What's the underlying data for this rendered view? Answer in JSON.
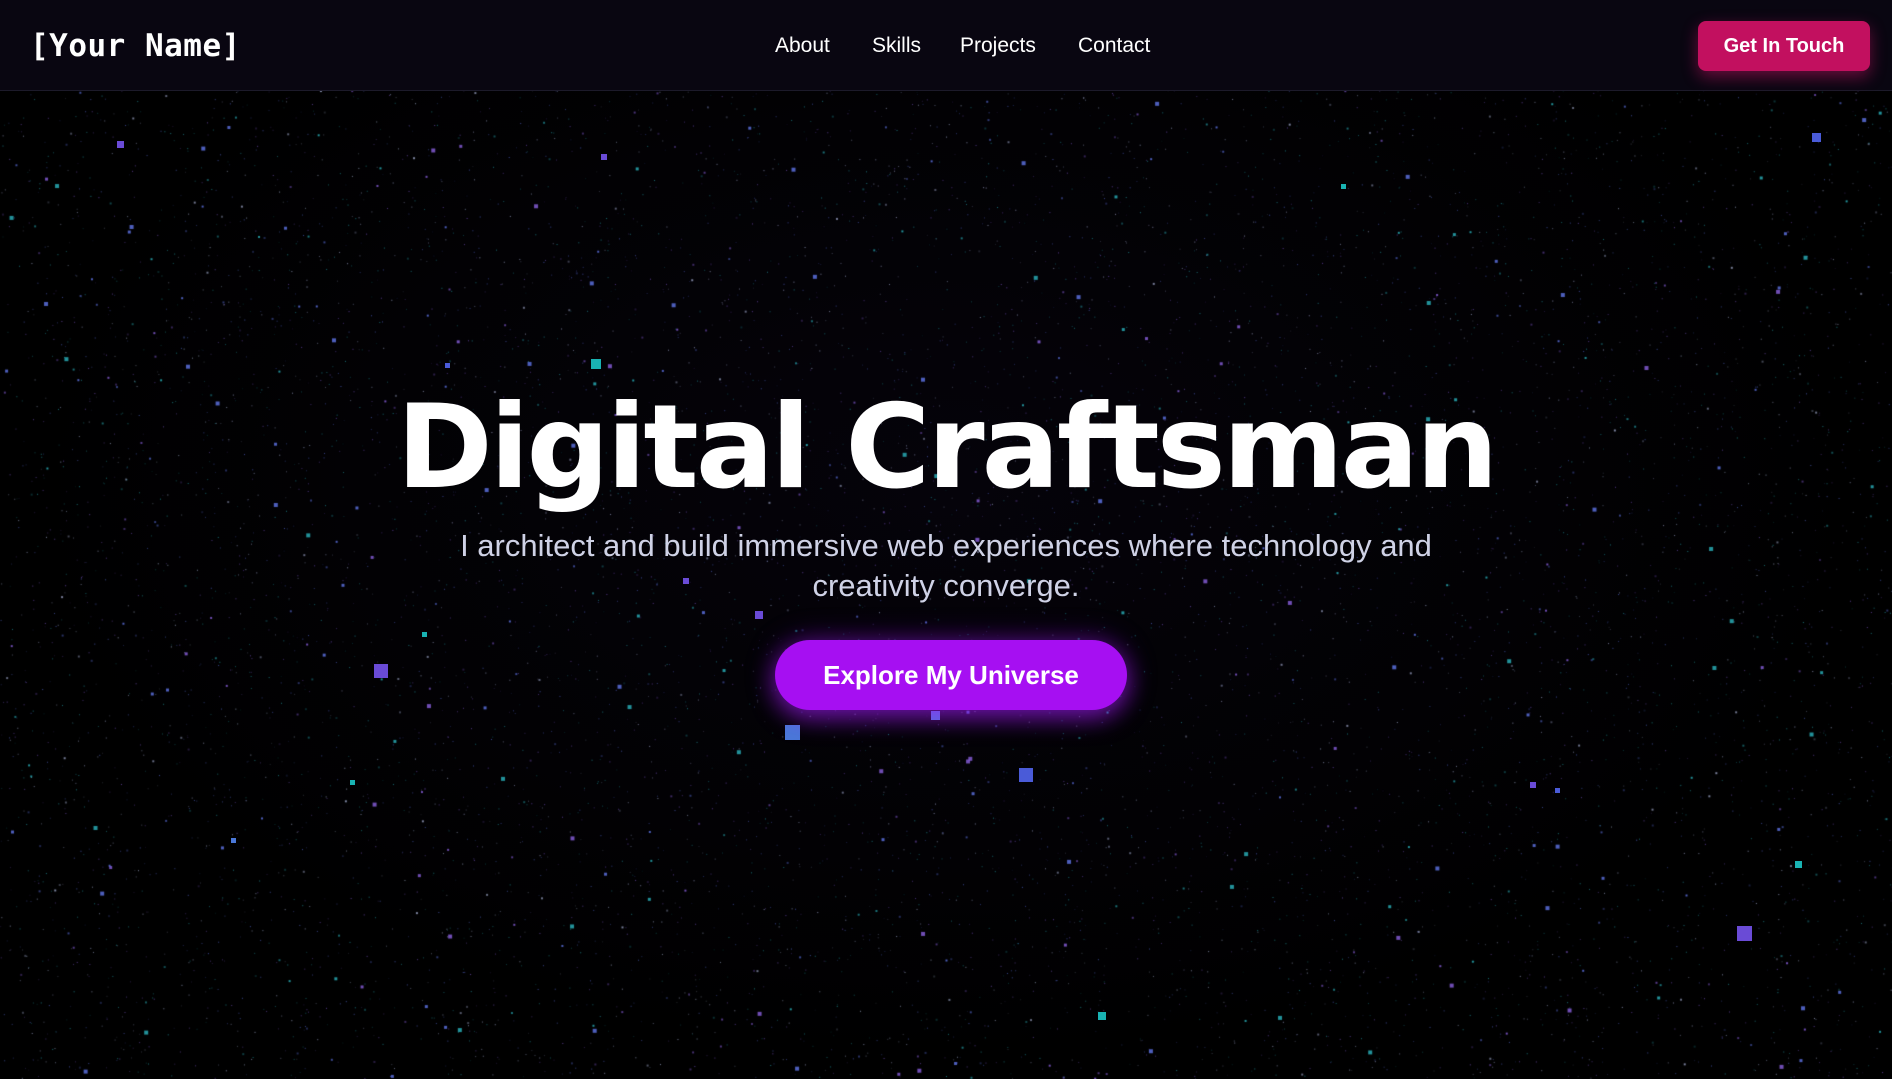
{
  "nav": {
    "brand": "[Your Name]",
    "links": [
      {
        "label": "About"
      },
      {
        "label": "Skills"
      },
      {
        "label": "Projects"
      },
      {
        "label": "Contact"
      }
    ],
    "cta_label": "Get In Touch"
  },
  "hero": {
    "title": "Digital Craftsman",
    "subtitle": "I architect and build immersive web experiences where technology and creativity converge.",
    "cta_label": "Explore My Universe"
  },
  "colors": {
    "background": "#000000",
    "nav_background": "#0a0612",
    "nav_cta": "#c2105f",
    "hero_cta": "#a60ff2",
    "particle_purple": "#6a4bd6",
    "particle_blue": "#4a78d8",
    "particle_teal": "#19b3b3"
  }
}
